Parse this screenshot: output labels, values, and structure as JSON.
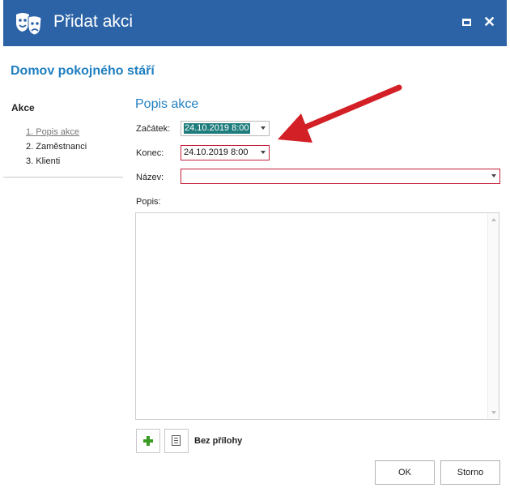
{
  "window": {
    "title": "Přidat akci",
    "icon": "theater-masks-icon"
  },
  "organization": {
    "title": "Domov pokojného stáří"
  },
  "sidebar": {
    "heading": "Akce",
    "steps": [
      {
        "label": "1. Popis akce",
        "active": true
      },
      {
        "label": "2. Zaměstnanci",
        "active": false
      },
      {
        "label": "3. Klienti",
        "active": false
      }
    ]
  },
  "form": {
    "section_title": "Popis akce",
    "start": {
      "label": "Začátek:",
      "value": "24.10.2019 8:00"
    },
    "end": {
      "label": "Konec:",
      "value": "24.10.2019 8:00"
    },
    "name": {
      "label": "Název:",
      "value": ""
    },
    "description": {
      "label": "Popis:",
      "value": ""
    }
  },
  "attachments": {
    "status": "Bez přílohy",
    "add_icon": "plus-icon",
    "notes_icon": "document-icon"
  },
  "buttons": {
    "ok": "OK",
    "cancel": "Storno"
  },
  "colors": {
    "titlebar": "#2b63a6",
    "accent": "#1f7fc0",
    "invalid_border": "#c41e3a",
    "annotation_arrow": "#d31f26"
  }
}
